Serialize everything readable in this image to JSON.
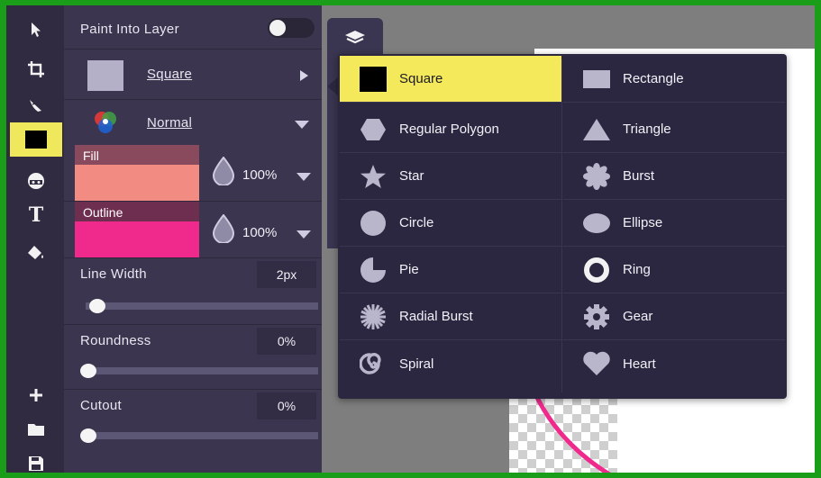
{
  "toolbar": {
    "tools": [
      {
        "name": "select-tool",
        "icon": "pointer-arrow-icon"
      },
      {
        "name": "crop-tool",
        "icon": "crop-icon"
      },
      {
        "name": "brush-tool",
        "icon": "brush-icon"
      },
      {
        "name": "shape-tool",
        "icon": "square-shape-icon",
        "active": true
      },
      {
        "name": "sticker-tool",
        "icon": "emoji-icon"
      },
      {
        "name": "text-tool",
        "icon": "text-icon",
        "glyph": "T"
      },
      {
        "name": "fill-tool",
        "icon": "paint-bucket-icon"
      }
    ],
    "bottom_tools": [
      {
        "name": "add-button",
        "icon": "plus-icon"
      },
      {
        "name": "open-folder-button",
        "icon": "folder-icon"
      },
      {
        "name": "save-button",
        "icon": "floppy-disk-icon"
      }
    ],
    "active_color": "#f0e85c"
  },
  "panel": {
    "paint_into_layer_label": "Paint Into Layer",
    "shape_label": "Square",
    "blend_label": "Normal",
    "fill": {
      "label": "Fill",
      "color": "#f28b82",
      "opacity": "100%"
    },
    "outline": {
      "label": "Outline",
      "color": "#ef2a8c",
      "opacity": "100%"
    },
    "line_width": {
      "label": "Line Width",
      "value": "2px"
    },
    "roundness": {
      "label": "Roundness",
      "value": "0%"
    },
    "cutout": {
      "label": "Cutout",
      "value": "0%"
    }
  },
  "shapes_menu": {
    "left": [
      {
        "label": "Square",
        "icon": "square-icon",
        "selected": true
      },
      {
        "label": "Regular Polygon",
        "icon": "hexagon-icon"
      },
      {
        "label": "Star",
        "icon": "star-icon"
      },
      {
        "label": "Circle",
        "icon": "circle-icon"
      },
      {
        "label": "Pie",
        "icon": "pie-icon"
      },
      {
        "label": "Radial Burst",
        "icon": "radial-burst-icon"
      },
      {
        "label": "Spiral",
        "icon": "spiral-icon"
      }
    ],
    "right": [
      {
        "label": "Rectangle",
        "icon": "rectangle-icon"
      },
      {
        "label": "Triangle",
        "icon": "triangle-icon"
      },
      {
        "label": "Burst",
        "icon": "burst-icon"
      },
      {
        "label": "Ellipse",
        "icon": "ellipse-icon"
      },
      {
        "label": "Ring",
        "icon": "ring-icon"
      },
      {
        "label": "Gear",
        "icon": "gear-icon"
      },
      {
        "label": "Heart",
        "icon": "heart-icon"
      }
    ]
  },
  "colors": {
    "frame": "#1a9e1a",
    "panel_bg": "#3b3550",
    "menu_bg": "#2b2740",
    "selected": "#f3e95b",
    "shape_icon": "#b9b6cc",
    "accent_pink": "#ef2a8c"
  }
}
